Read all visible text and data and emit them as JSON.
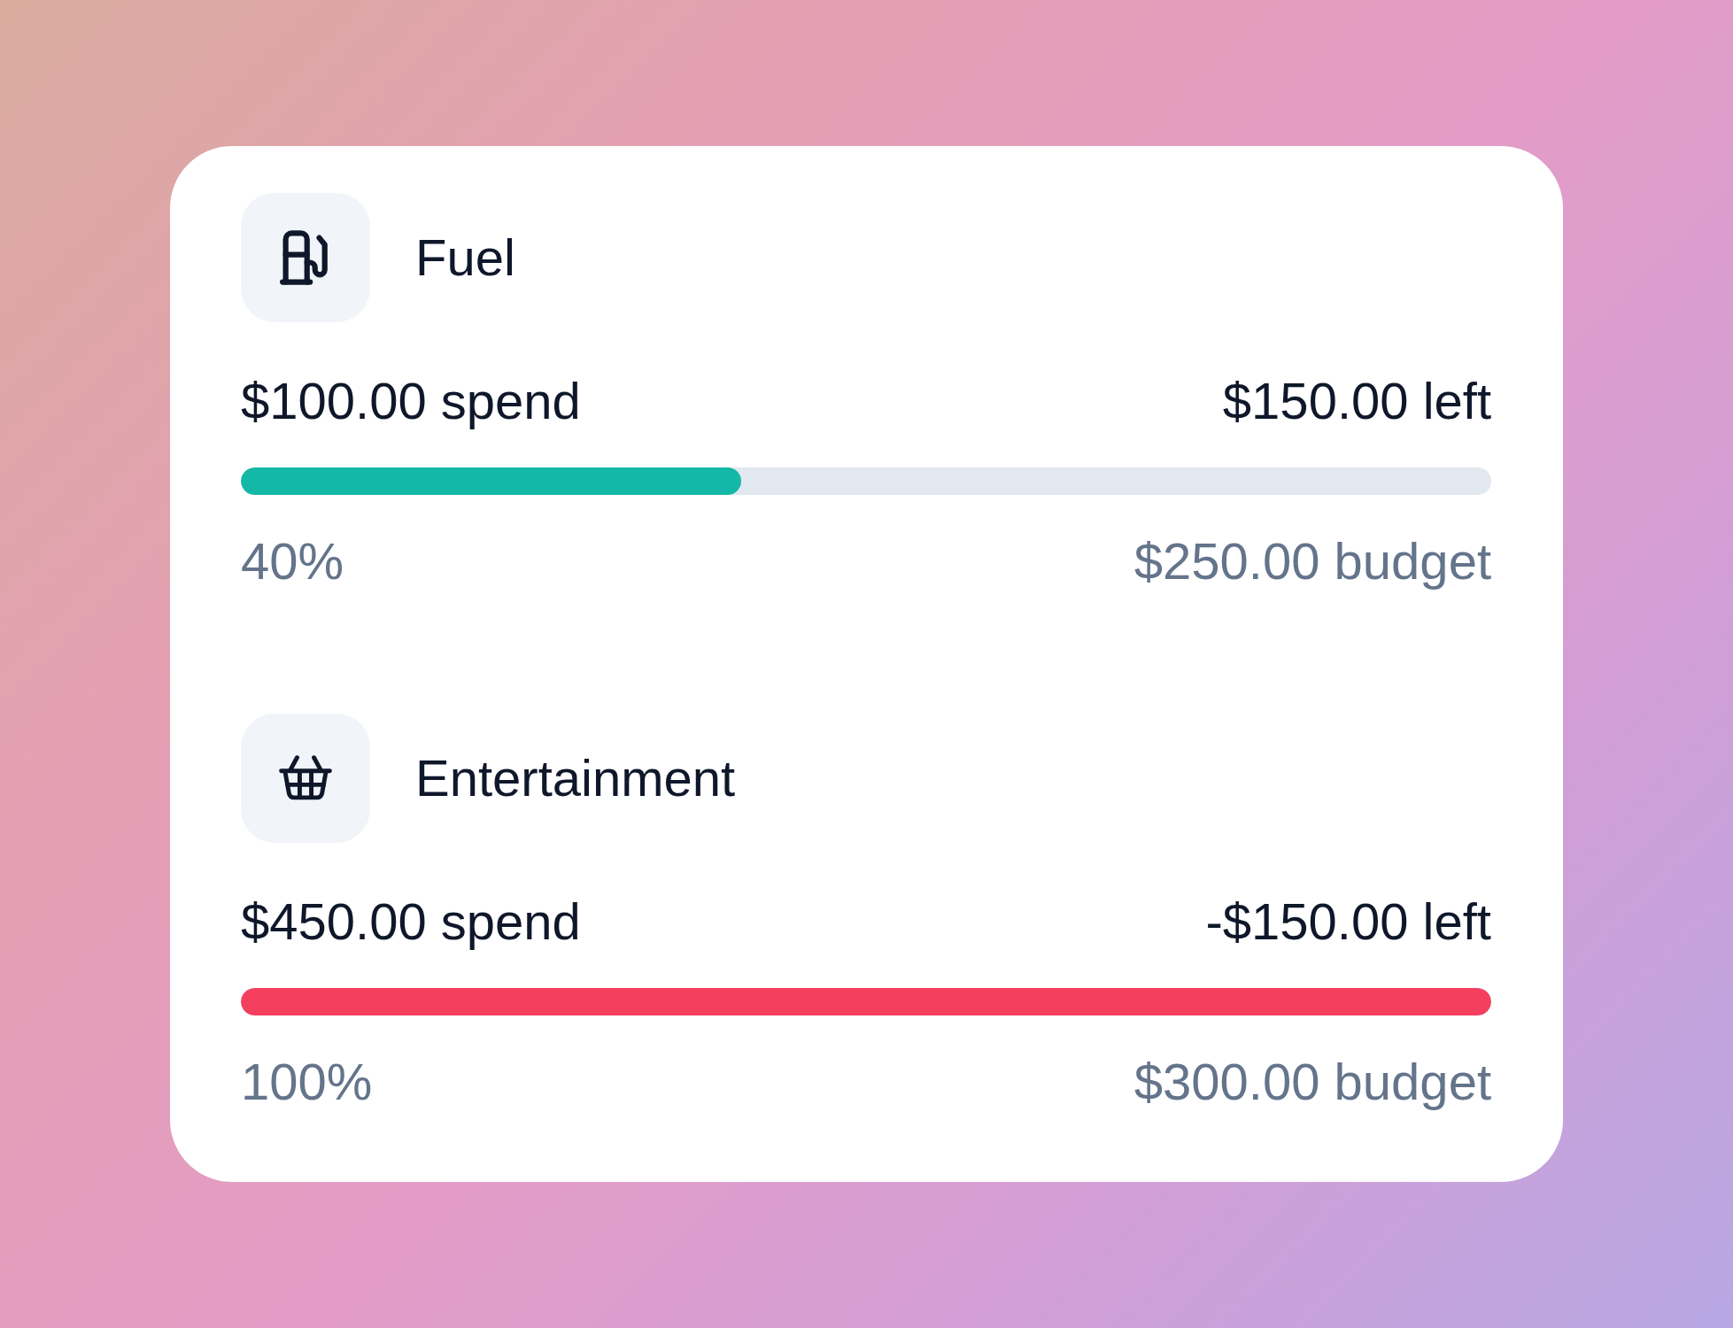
{
  "categories": [
    {
      "name": "Fuel",
      "spent": "$100.00 spend",
      "left": "$150.00 left",
      "level": 0.4,
      "color": "#14b8a6",
      "percent": "40%",
      "budget": "$250.00 budget"
    },
    {
      "name": "Entertainment",
      "spent": "$450.00 spend",
      "left": "-$150.00 left",
      "level": 1.0,
      "color": "#f43f5e",
      "percent": "100%",
      "budget": "$300.00 budget"
    }
  ]
}
